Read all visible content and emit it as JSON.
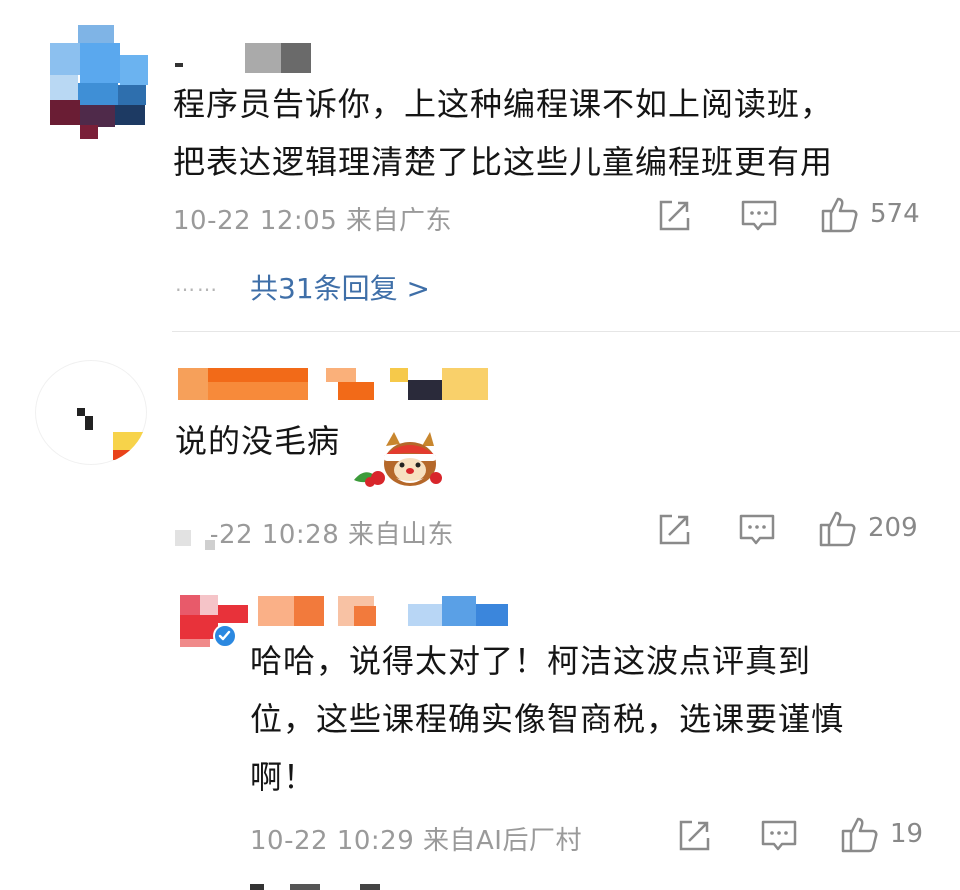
{
  "comments": [
    {
      "text_lines": [
        "程序员告诉你，上这种编程课不如上阅读班，",
        "把表达逻辑理清楚了比这些儿童编程班更有用"
      ],
      "meta": "10-22 12:05 来自广东",
      "like_count": "574",
      "replies_link": "共31条回复 >",
      "replies_dots": "……"
    },
    {
      "text": "说的没毛病",
      "meta": "10-22 10:28 来自山东",
      "like_count": "209",
      "icon": "santa-reindeer-emoji"
    },
    {
      "text_lines": [
        "哈哈，说得太对了！柯洁这波点评真到",
        "位，这些课程确实像智商税，选课要谨慎",
        "啊！"
      ],
      "meta": "10-22 10:29 来自AI后厂村",
      "like_count": "19",
      "verified": true
    }
  ],
  "icons": {
    "share": "share-icon",
    "comment": "comment-icon",
    "like": "thumbs-up-icon"
  },
  "colors": {
    "link": "#3f6fa8",
    "meta": "#9a9a9a",
    "text": "#151515"
  }
}
